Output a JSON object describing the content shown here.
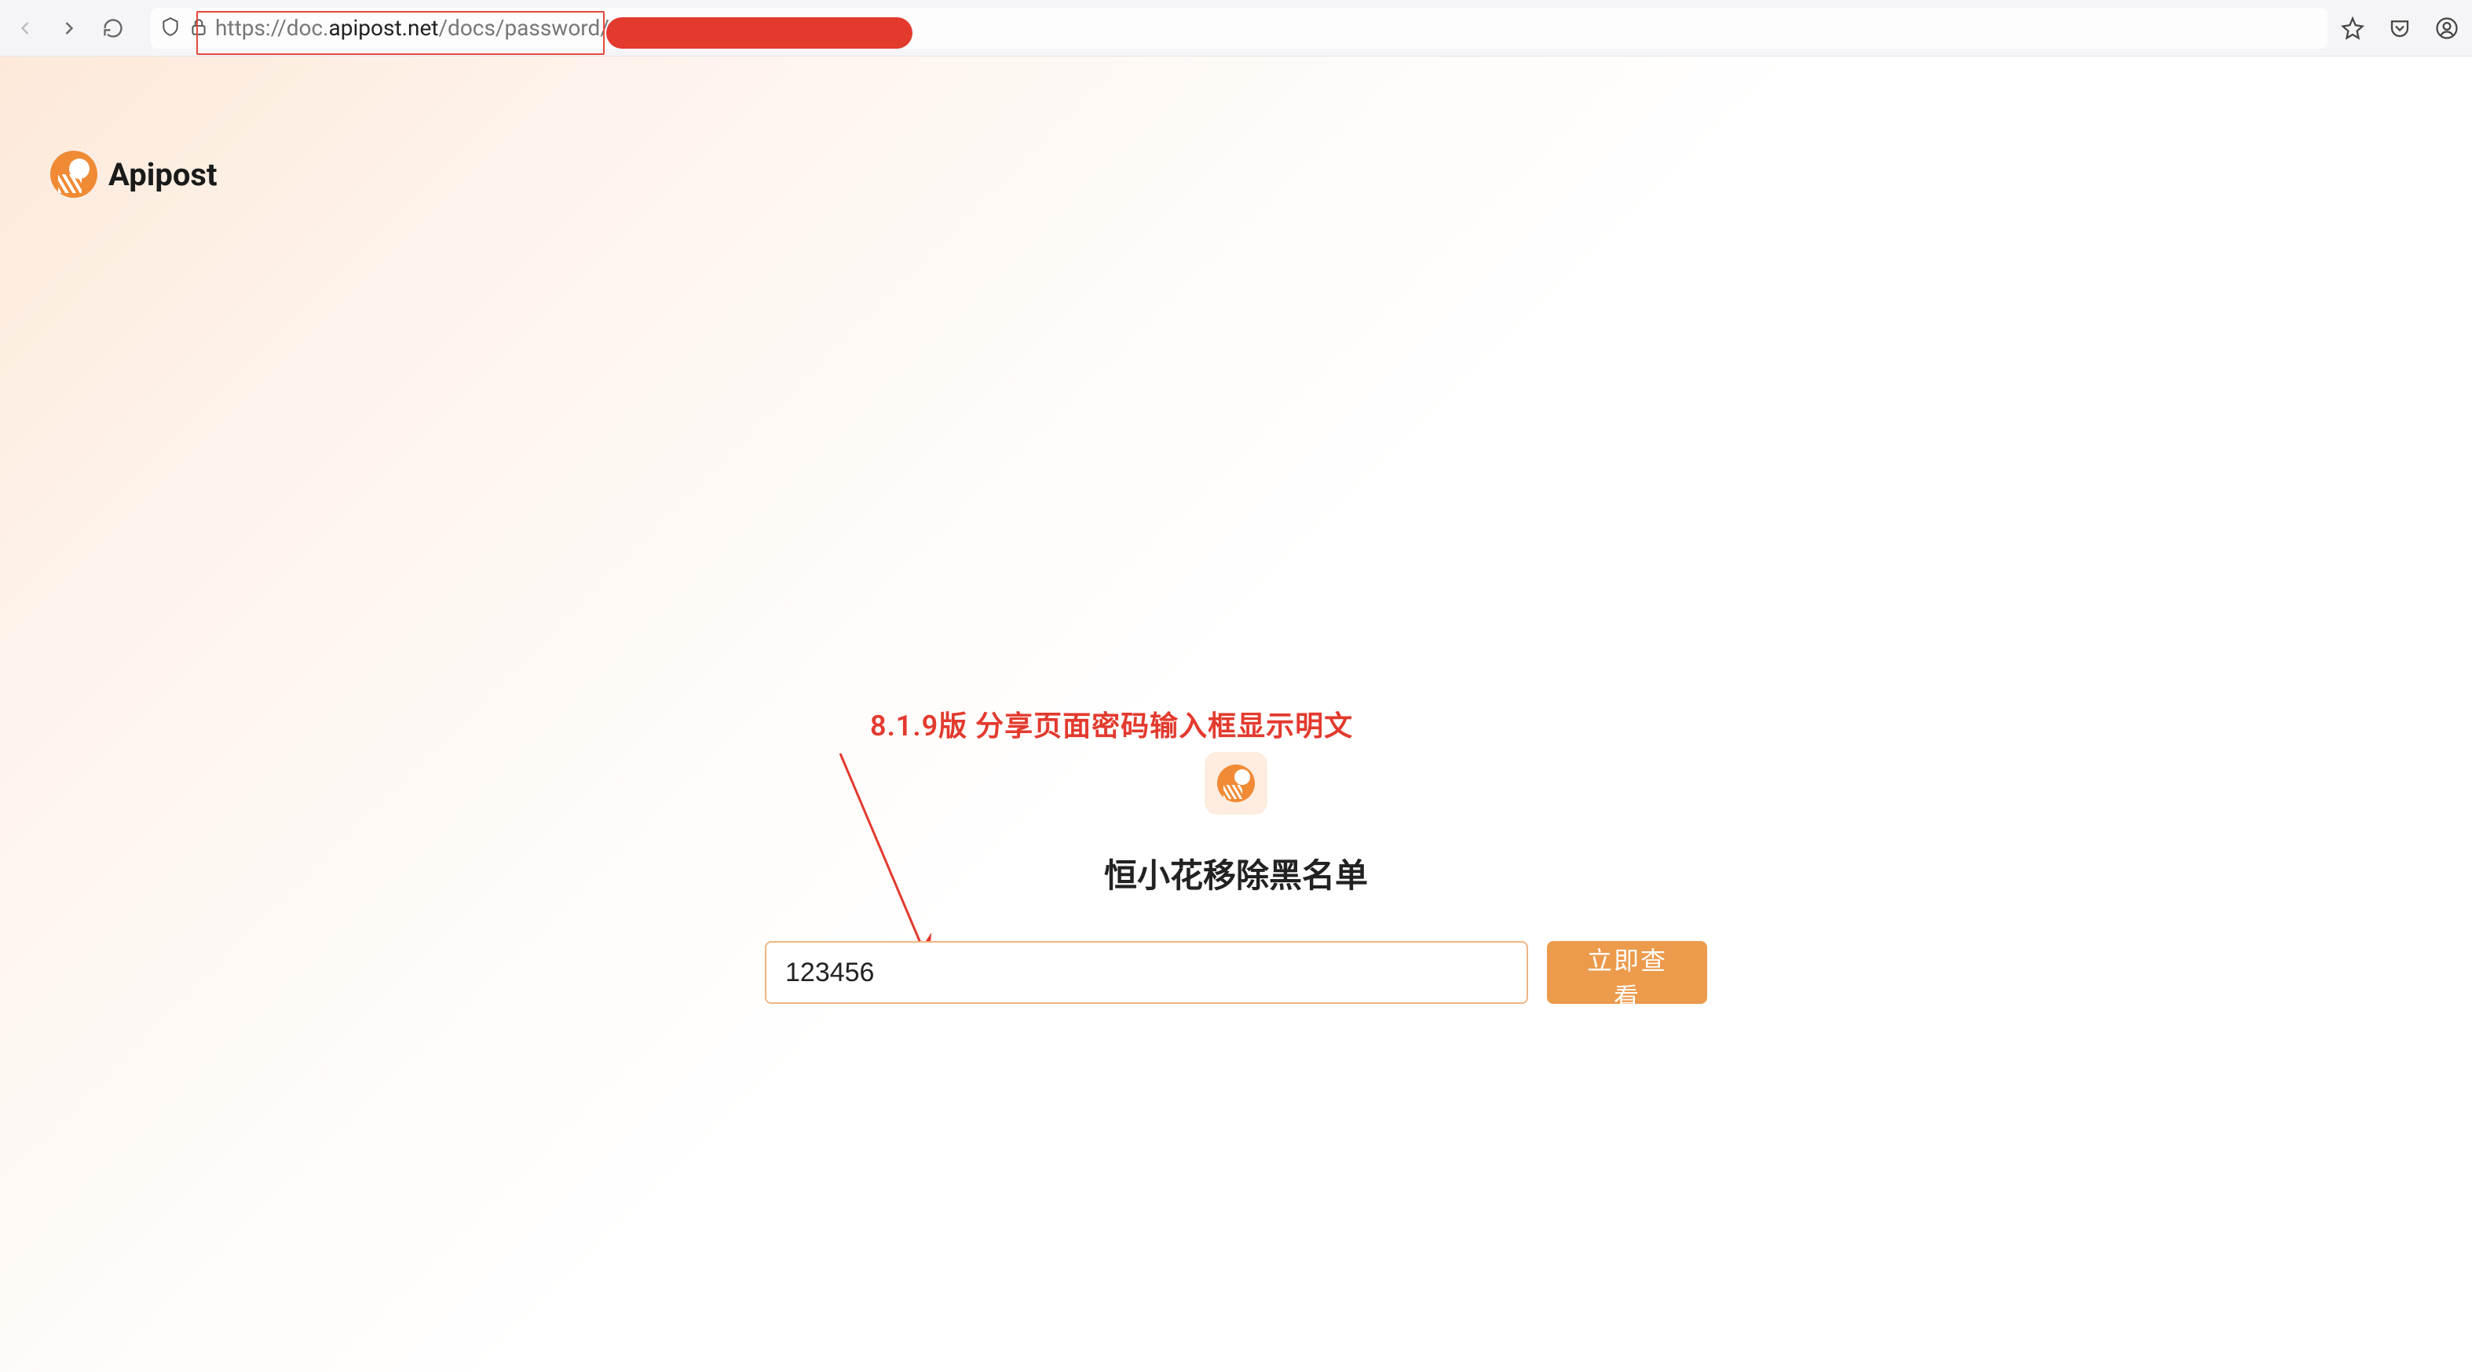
{
  "browser": {
    "url_display_prefix": "https://doc.",
    "url_display_host": "apipost.net",
    "url_display_suffix": "/docs/password/"
  },
  "brand": {
    "name": "Apipost"
  },
  "annotation": {
    "text": "8.1.9版 分享页面密码输入框显示明文"
  },
  "doc": {
    "title": "恒小花移除黑名单",
    "password_value": "123456",
    "password_placeholder": "",
    "view_button": "立即查看"
  },
  "colors": {
    "accent": "#f08a34",
    "button": "#ec9a4b",
    "annotation": "#e33a2e",
    "input_border": "#f0b583"
  }
}
